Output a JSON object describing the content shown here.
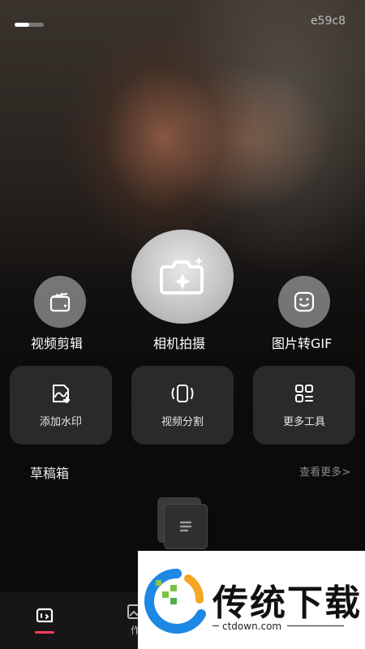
{
  "status": {
    "device_id": "e59c8"
  },
  "actions": {
    "video_edit": "视频剪辑",
    "camera": "相机拍摄",
    "gif": "图片转GIF"
  },
  "tools": [
    {
      "label": "添加水印",
      "icon": "watermark-icon"
    },
    {
      "label": "视频分割",
      "icon": "video-split-icon"
    },
    {
      "label": "更多工具",
      "icon": "grid-icon"
    }
  ],
  "drafts": {
    "title": "草稿箱",
    "more": "查看更多>"
  },
  "tabbar": {
    "tab2_label": "作"
  },
  "ad": {
    "brand": "传统下载",
    "domain": "ctdown.com"
  },
  "colors": {
    "accent": "#ff3b5c",
    "tile_bg": "#2a2a2a"
  }
}
